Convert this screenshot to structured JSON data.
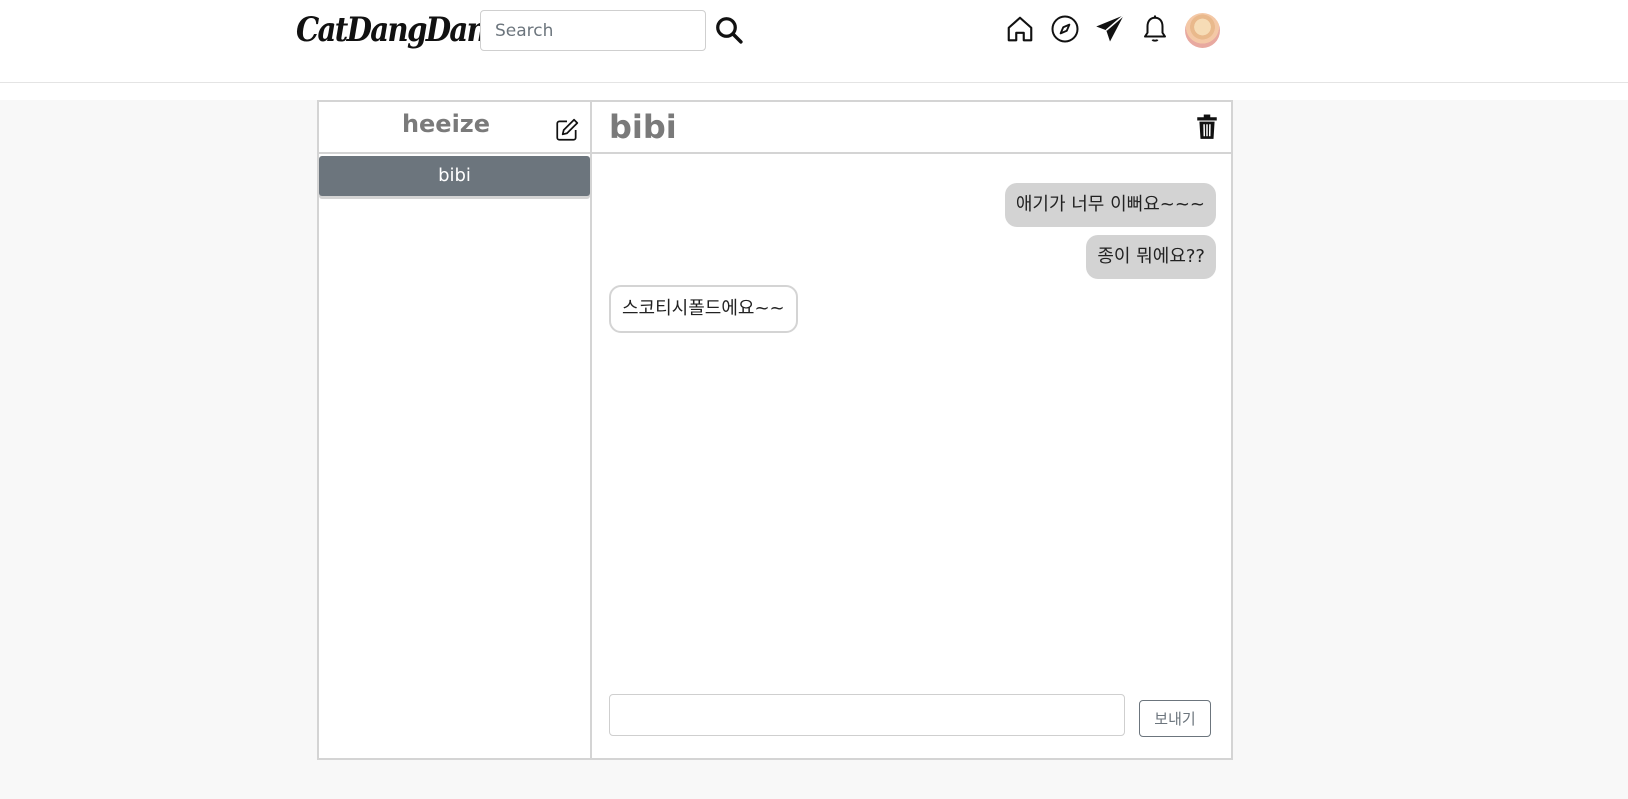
{
  "app": {
    "logo_text": "CatDangDang"
  },
  "header": {
    "search": {
      "placeholder": "Search",
      "value": ""
    },
    "icons": [
      "home-icon",
      "explore-compass-icon",
      "direct-message-paper-plane-icon",
      "notifications-bell-icon",
      "profile-avatar"
    ]
  },
  "dm": {
    "current_user": "heeize",
    "conversations": [
      {
        "label": "bibi",
        "selected": true
      }
    ],
    "chat": {
      "title": "bibi",
      "messages": [
        {
          "text": "애기가 너무 이뻐요~~~",
          "direction": "sent"
        },
        {
          "text": "종이 뭐에요??",
          "direction": "sent"
        },
        {
          "text": "스코티시폴드에요~~",
          "direction": "received"
        }
      ],
      "input_value": "",
      "send_label": "보내기"
    }
  },
  "colors": {
    "selected_conversation_bg": "#6c757d",
    "sent_bubble_bg": "#d3d3d3",
    "panel_border": "#d4d4d4",
    "page_bg": "#f8f8f8"
  }
}
